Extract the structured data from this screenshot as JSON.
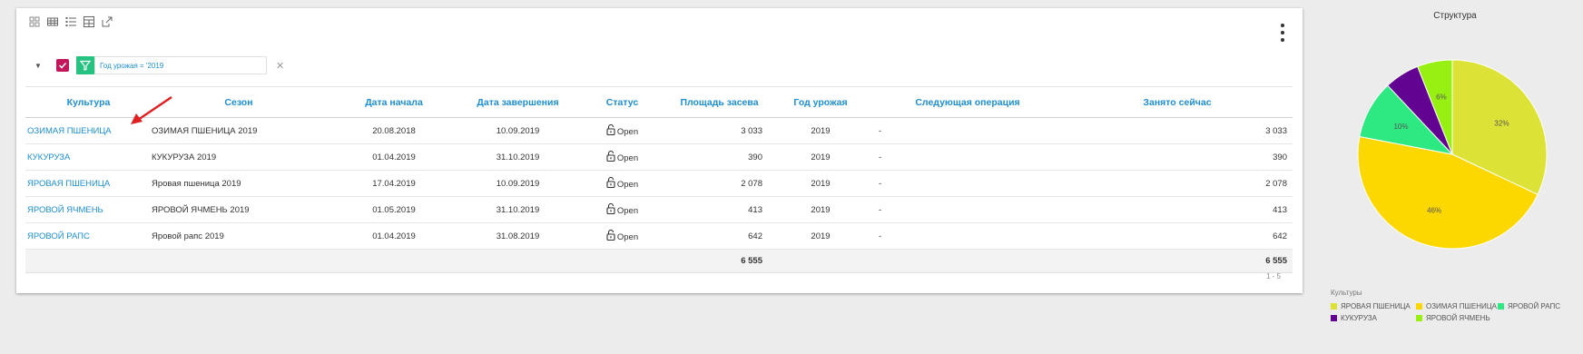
{
  "toolbar": {
    "icons": [
      "grid-view-icon",
      "table-view-icon",
      "checklist-icon",
      "layout-icon",
      "export-icon"
    ]
  },
  "filter": {
    "value": "Год урожая = '2019"
  },
  "columns": [
    "Культура",
    "Сезон",
    "Дата начала",
    "Дата завершения",
    "Статус",
    "Площадь засева",
    "Год урожая",
    "Следующая операция",
    "Занято сейчас"
  ],
  "rows": [
    {
      "culture": "ОЗИМАЯ ПШЕНИЦА",
      "season": "ОЗИМАЯ ПШЕНИЦА 2019",
      "start": "20.08.2018",
      "end": "10.09.2019",
      "status": "Open",
      "area": "3 033",
      "year": "2019",
      "next": "-",
      "occupied": "3 033"
    },
    {
      "culture": "КУКУРУЗА",
      "season": "КУКУРУЗА 2019",
      "start": "01.04.2019",
      "end": "31.10.2019",
      "status": "Open",
      "area": "390",
      "year": "2019",
      "next": "-",
      "occupied": "390"
    },
    {
      "culture": "ЯРОВАЯ ПШЕНИЦА",
      "season": "Яровая пшеница 2019",
      "start": "17.04.2019",
      "end": "10.09.2019",
      "status": "Open",
      "area": "2 078",
      "year": "2019",
      "next": "-",
      "occupied": "2 078"
    },
    {
      "culture": "ЯРОВОЙ ЯЧМЕНЬ",
      "season": "ЯРОВОЙ ЯЧМЕНЬ 2019",
      "start": "01.05.2019",
      "end": "31.10.2019",
      "status": "Open",
      "area": "413",
      "year": "2019",
      "next": "-",
      "occupied": "413"
    },
    {
      "culture": "ЯРОВОЙ РАПС",
      "season": "Яровой рапс 2019",
      "start": "01.04.2019",
      "end": "31.08.2019",
      "status": "Open",
      "area": "642",
      "year": "2019",
      "next": "-",
      "occupied": "642"
    }
  ],
  "totals": {
    "area": "6 555",
    "occupied": "6 555"
  },
  "pager": {
    "text": "1 - 5"
  },
  "chart_data": {
    "type": "pie",
    "title": "Структура",
    "legend_title": "Культуры",
    "legend_placement": "bottom",
    "slices": [
      {
        "name": "ЯРОВАЯ ПШЕНИЦА",
        "value": 32,
        "label": "32%",
        "color": "#dce336"
      },
      {
        "name": "ОЗИМАЯ ПШЕНИЦА",
        "value": 46,
        "label": "46%",
        "color": "#fcd700"
      },
      {
        "name": "ЯРОВОЙ РАПС",
        "value": 10,
        "label": "10%",
        "color": "#2ee882"
      },
      {
        "name": "КУКУРУЗА",
        "value": 6,
        "label": "",
        "color": "#620391"
      },
      {
        "name": "ЯРОВОЙ ЯЧМЕНЬ",
        "value": 6,
        "label": "6%",
        "color": "#98f012"
      }
    ]
  }
}
